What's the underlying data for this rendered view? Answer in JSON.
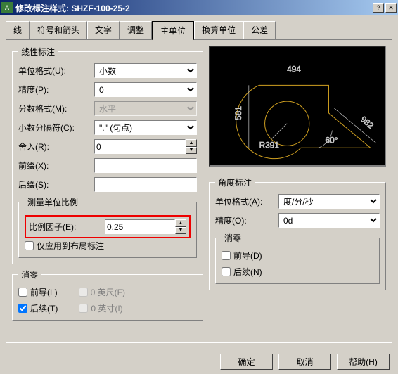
{
  "window": {
    "title": "修改标注样式: SHZF-100-25-2"
  },
  "tabs": [
    "线",
    "符号和箭头",
    "文字",
    "调整",
    "主单位",
    "换算单位",
    "公差"
  ],
  "active_tab": 4,
  "linear": {
    "legend": "线性标注",
    "unit_format_label": "单位格式(U):",
    "unit_format": "小数",
    "precision_label": "精度(P):",
    "precision": "0",
    "fraction_label": "分数格式(M):",
    "fraction": "水平",
    "decimal_sep_label": "小数分隔符(C):",
    "decimal_sep": "\".\" (句点)",
    "round_label": "舍入(R):",
    "round": "0",
    "prefix_label": "前缀(X):",
    "prefix": "",
    "suffix_label": "后缀(S):",
    "suffix": ""
  },
  "scale": {
    "legend": "测量单位比例",
    "factor_label": "比例因子(E):",
    "factor": "0.25",
    "layout_only": "仅应用到布局标注"
  },
  "suppress_l": {
    "legend": "消零",
    "leading": "前导(L)",
    "feet": "0 英尺(F)",
    "trailing": "后续(T)",
    "inches": "0 英寸(I)"
  },
  "angular": {
    "legend": "角度标注",
    "format_label": "单位格式(A):",
    "format": "度/分/秒",
    "precision_label": "精度(O):",
    "precision": "0d"
  },
  "suppress_r": {
    "legend": "消零",
    "leading": "前导(D)",
    "trailing": "后续(N)"
  },
  "preview": {
    "d1": "494",
    "d2": "581",
    "d3": "982",
    "a": "60°",
    "r": "R391"
  },
  "buttons": {
    "ok": "确定",
    "cancel": "取消",
    "help": "帮助(H)"
  }
}
